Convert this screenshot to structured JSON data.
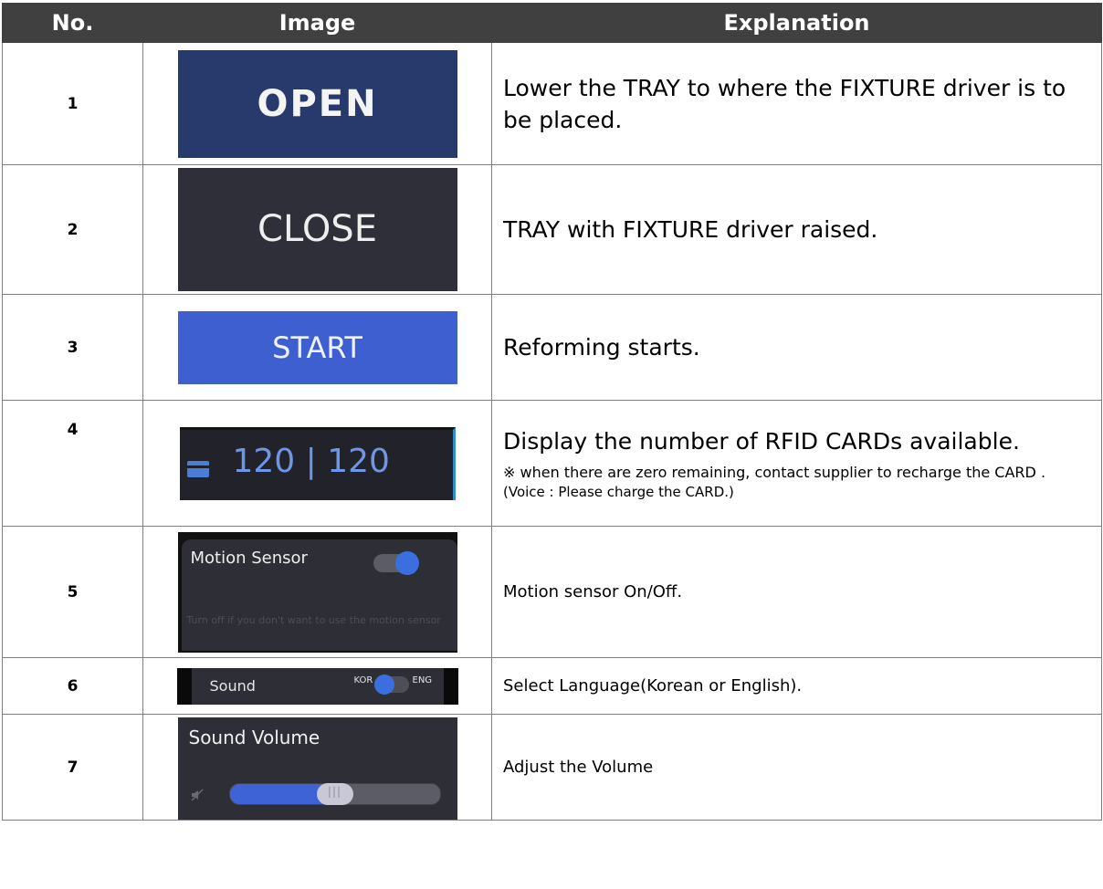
{
  "header": {
    "col_no": "No.",
    "col_image": "Image",
    "col_explanation": "Explanation"
  },
  "rows": [
    {
      "no": "1",
      "image_label": "OPEN",
      "explanation": "Lower the TRAY to where the FIXTURE driver is to be placed."
    },
    {
      "no": "2",
      "image_label": "CLOSE",
      "explanation": "TRAY with FIXTURE driver raised."
    },
    {
      "no": "3",
      "image_label": "START",
      "explanation": "Reforming starts."
    },
    {
      "no": "4",
      "image_count": "120 | 120",
      "explanation": "Display the number of RFID CARDs available.",
      "note": "※ when there are zero remaining, contact supplier to recharge the CARD .",
      "voice": "(Voice : Please charge the CARD.)"
    },
    {
      "no": "5",
      "image_title": "Motion Sensor",
      "image_hint": "Turn off if you don't want to use the motion sensor",
      "toggle_on": true,
      "explanation": "Motion sensor On/Off."
    },
    {
      "no": "6",
      "image_label": "Sound",
      "lang_left": "KOR",
      "lang_right": "ENG",
      "explanation": "Select Language(Korean or English)."
    },
    {
      "no": "7",
      "image_title": "Sound Volume",
      "volume_percent": 50,
      "explanation": "Adjust the Volume"
    }
  ],
  "colors": {
    "header_bg": "#404040",
    "accent_blue": "#3b6fe0",
    "panel_dark": "#2e2e36"
  }
}
